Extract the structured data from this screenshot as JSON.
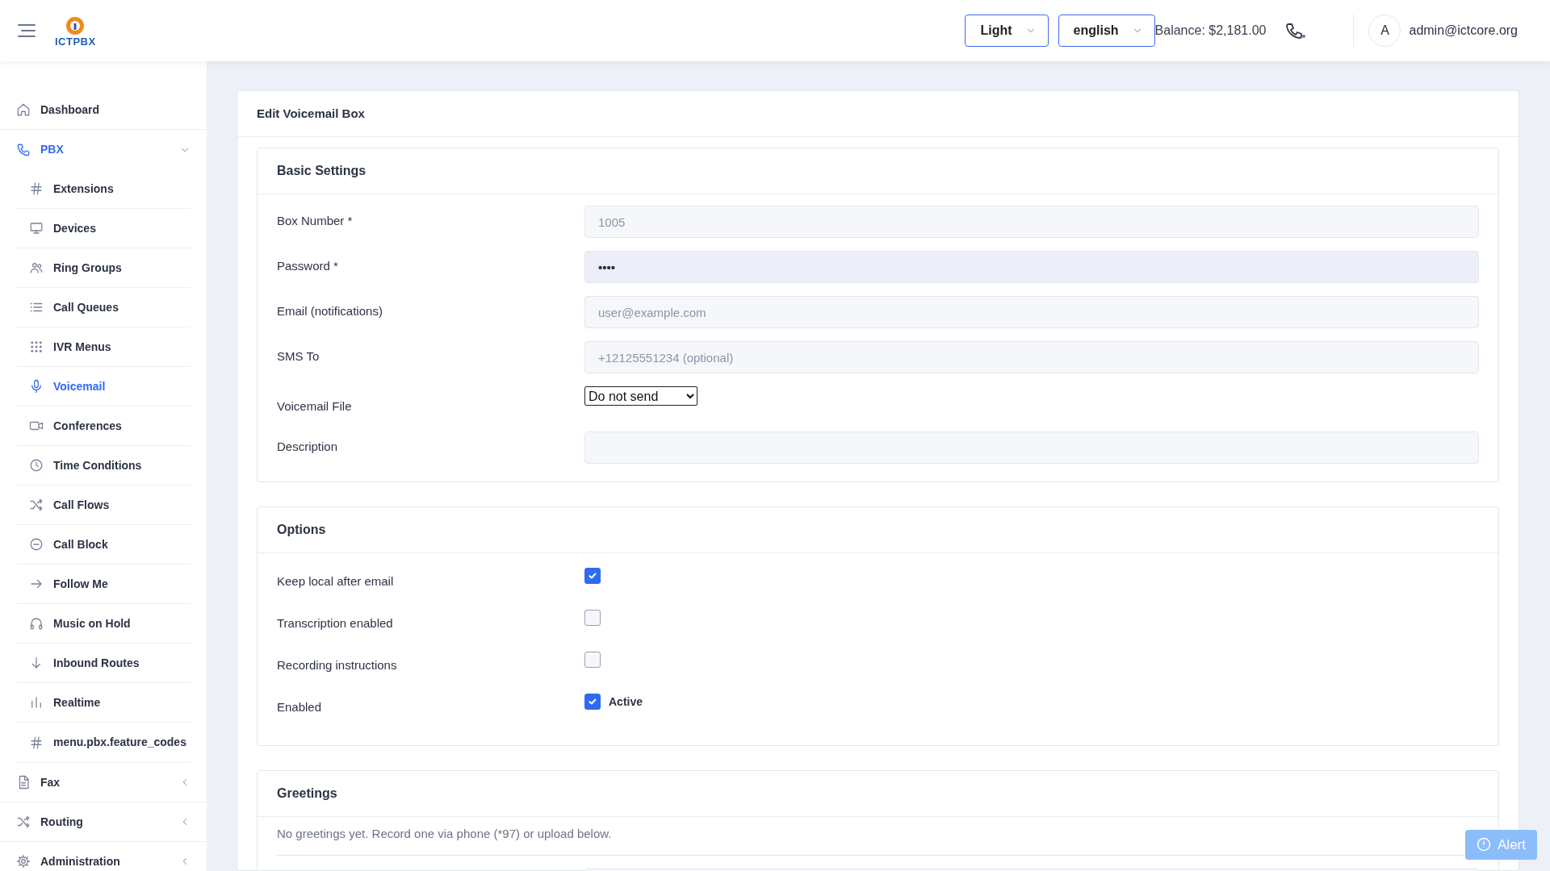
{
  "header": {
    "logo_text": "ICTPBX",
    "theme_select": "Light",
    "language_select": "english",
    "balance": "Balance: $2,181.00",
    "avatar": "A",
    "user": "admin@ictcore.org"
  },
  "sidebar": {
    "items": [
      {
        "label": "Dashboard",
        "selected": false
      },
      {
        "label": "PBX",
        "selected": true,
        "expanded": true,
        "children": [
          {
            "label": "Extensions",
            "selected": false
          },
          {
            "label": "Devices",
            "selected": false
          },
          {
            "label": "Ring Groups",
            "selected": false
          },
          {
            "label": "Call Queues",
            "selected": false
          },
          {
            "label": "IVR Menus",
            "selected": false
          },
          {
            "label": "Voicemail",
            "selected": true
          },
          {
            "label": "Conferences",
            "selected": false
          },
          {
            "label": "Time Conditions",
            "selected": false
          },
          {
            "label": "Call Flows",
            "selected": false
          },
          {
            "label": "Call Block",
            "selected": false
          },
          {
            "label": "Follow Me",
            "selected": false
          },
          {
            "label": "Music on Hold",
            "selected": false
          },
          {
            "label": "Inbound Routes",
            "selected": false
          },
          {
            "label": "Realtime",
            "selected": false
          },
          {
            "label": "menu.pbx.feature_codes",
            "selected": false
          }
        ]
      },
      {
        "label": "Fax",
        "selected": false,
        "expanded": false
      },
      {
        "label": "Routing",
        "selected": false,
        "expanded": false
      },
      {
        "label": "Administration",
        "selected": false,
        "expanded": false
      }
    ]
  },
  "page": {
    "title": "Edit Voicemail Box",
    "sections": [
      {
        "title": "Basic Settings",
        "kind": "fields",
        "fields": [
          {
            "label": "Box Number *",
            "kind": "text",
            "placeholder": "1005"
          },
          {
            "label": "Password *",
            "kind": "password",
            "value": "••••"
          },
          {
            "label": "Email (notifications)",
            "kind": "text",
            "placeholder": "user@example.com"
          },
          {
            "label": "SMS To",
            "kind": "text",
            "placeholder": "+12125551234 (optional)"
          },
          {
            "label": "Voicemail File",
            "kind": "select",
            "value": "Do not send"
          },
          {
            "label": "Description",
            "kind": "text"
          }
        ]
      },
      {
        "title": "Options",
        "kind": "checks",
        "fields": [
          {
            "label": "Keep local after email",
            "checked": true
          },
          {
            "label": "Transcription enabled",
            "checked": false
          },
          {
            "label": "Recording instructions",
            "checked": false
          },
          {
            "label": "Enabled",
            "checked": true,
            "caption": "Active"
          }
        ]
      },
      {
        "title": "Greetings",
        "kind": "note",
        "note": "No greetings yet. Record one via phone (*97) or upload below."
      }
    ]
  },
  "alert_button": "Alert"
}
